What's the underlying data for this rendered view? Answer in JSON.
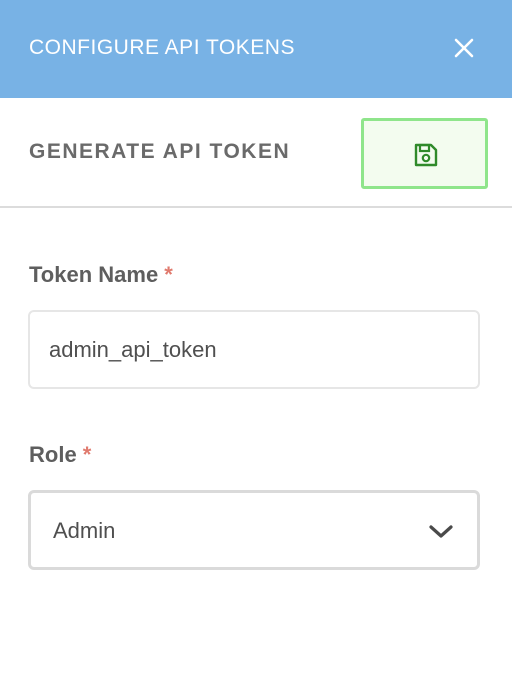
{
  "header": {
    "title": "CONFIGURE API TOKENS",
    "close_icon": "close-icon"
  },
  "subheader": {
    "title": "GENERATE API TOKEN",
    "save_icon": "floppy-disk-icon"
  },
  "form": {
    "token_name": {
      "label": "Token Name",
      "required_marker": "*",
      "value": "admin_api_token"
    },
    "role": {
      "label": "Role",
      "required_marker": "*",
      "selected": "Admin",
      "chevron_icon": "chevron-down-icon"
    }
  },
  "colors": {
    "header_bg": "#78b2e5",
    "save_border": "#8fe58b",
    "save_icon": "#2f8a2a",
    "required": "#e07a6e"
  }
}
